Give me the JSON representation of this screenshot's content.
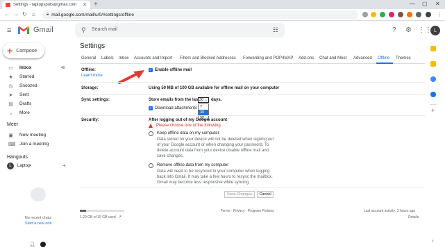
{
  "browser": {
    "tab_title": "Settings - laptopspots@gmail.com",
    "tab_close": "✕",
    "new_tab": "+",
    "url": "mail.google.com/mail/u/0/#settings/offline",
    "window_controls": [
      "—",
      "▢",
      "✕"
    ]
  },
  "header": {
    "app_name": "Gmail",
    "search_placeholder": "Search mail",
    "avatar_letter": "L"
  },
  "sidebar": {
    "compose_label": "Compose",
    "items": [
      {
        "label": "Inbox",
        "count": "48",
        "icon": "inbox-icon",
        "glyph": "▭"
      },
      {
        "label": "Starred",
        "count": "",
        "icon": "star-icon",
        "glyph": "★"
      },
      {
        "label": "Snoozed",
        "count": "",
        "icon": "clock-icon",
        "glyph": "◷"
      },
      {
        "label": "Sent",
        "count": "",
        "icon": "send-icon",
        "glyph": "➤"
      },
      {
        "label": "Drafts",
        "count": "",
        "icon": "draft-icon",
        "glyph": "▤"
      },
      {
        "label": "More",
        "count": "",
        "icon": "chevron-down-icon",
        "glyph": "⌄"
      }
    ],
    "meet_title": "Meet",
    "meet_items": [
      {
        "label": "New meeting",
        "glyph": "▣"
      },
      {
        "label": "Join a meeting",
        "glyph": "⌨"
      }
    ],
    "hangouts_title": "Hangouts",
    "hangouts_user": "Laptop",
    "hangouts_user_letter": "L",
    "no_chats": "No recent chats",
    "start_chat": "Start a new one"
  },
  "settings": {
    "title": "Settings",
    "tabs": [
      "General",
      "Labels",
      "Inbox",
      "Accounts and Import",
      "Filters and Blocked Addresses",
      "Forwarding and POP/IMAP",
      "Add-ons",
      "Chat and Meet",
      "Advanced",
      "Offline",
      "Themes"
    ],
    "active_tab": "Offline",
    "offline_label": "Offline:",
    "learn_more": "Learn more",
    "enable_offline": "Enable offline mail",
    "storage_label": "Storage:",
    "storage_text": "Using 50 MB of 100 GB available for offline mail on your computer",
    "sync_label": "Sync settings:",
    "sync_prefix": "Store emails from the last",
    "sync_value": "30",
    "sync_suffix": "days.",
    "download_attachments": "Download attachments",
    "sync_options": [
      "7",
      "30",
      "90"
    ],
    "security_label": "Security:",
    "security_heading": "After logging out of my Google account",
    "warning": "Please choose one of the following",
    "keep_title": "Keep offline data on my computer",
    "keep_desc": "Data stored on your device will not be deleted when signing out of your Google account or when changing your password. To delete account data from your device disable offline mail and save changes.",
    "remove_title": "Remove offline data from my computer",
    "remove_desc": "Data will need to be resynced to your computer when logging back into Gmail. It may take a few hours to resync the mailbox. Gmail may become less responsive while syncing.",
    "save_label": "Save Changes",
    "cancel_label": "Cancel"
  },
  "footer": {
    "storage_used": "1.29 GB of 15 GB used",
    "links": "Terms · Privacy · Program Policies",
    "last_activity": "Last account activity: 3 hours ago",
    "details": "Details"
  },
  "colors": {
    "accent": "#1a73e8",
    "warning": "#d93025",
    "arrow": "#e53935"
  }
}
